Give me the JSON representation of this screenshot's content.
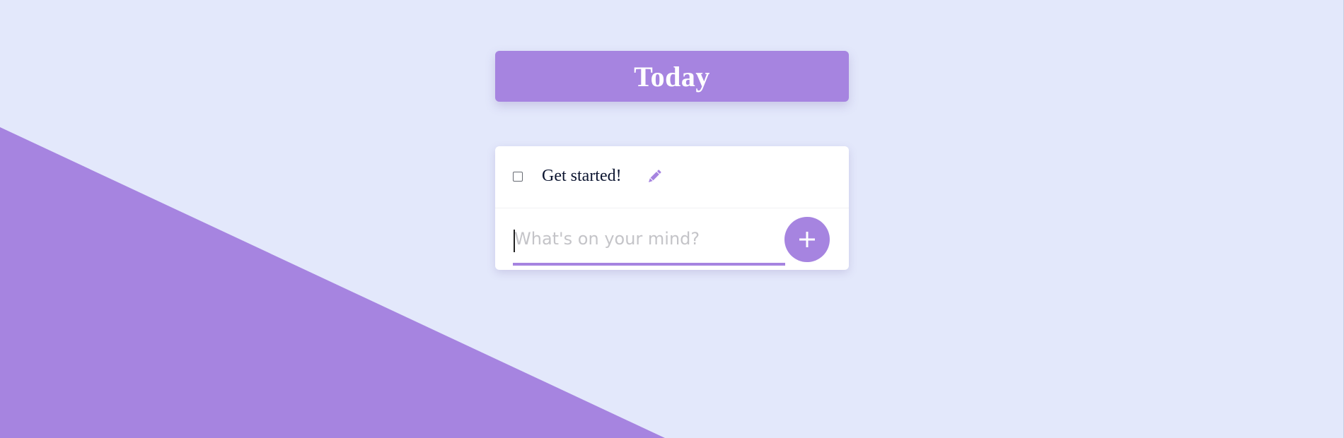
{
  "colors": {
    "background": "#e3e8fb",
    "accent": "#a684e0",
    "card": "#ffffff",
    "text": "#0c1530",
    "placeholder": "#c4c4c8"
  },
  "header": {
    "title": "Today"
  },
  "todos": [
    {
      "label": "Get started!",
      "checked": false,
      "edit_icon": "pencil-icon"
    }
  ],
  "new_todo": {
    "placeholder": "What's on your mind?",
    "value": "",
    "add_icon": "plus-icon"
  }
}
